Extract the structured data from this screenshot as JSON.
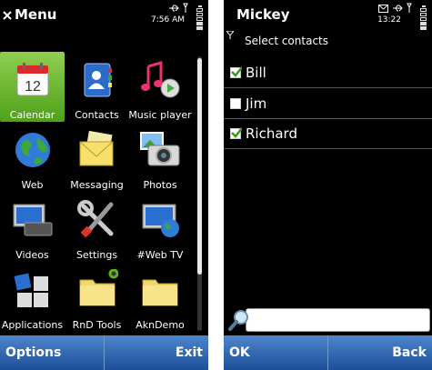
{
  "left": {
    "title": "Menu",
    "time": "7:56 AM",
    "apps": [
      {
        "label": "Calendar",
        "icon": "calendar-icon",
        "badge": "12",
        "selected": true
      },
      {
        "label": "Contacts",
        "icon": "contacts-icon"
      },
      {
        "label": "Music player",
        "icon": "music-player-icon"
      },
      {
        "label": "Web",
        "icon": "globe-icon"
      },
      {
        "label": "Messaging",
        "icon": "envelope-icon"
      },
      {
        "label": "Photos",
        "icon": "camera-icon"
      },
      {
        "label": "Videos",
        "icon": "video-screen-icon"
      },
      {
        "label": "Settings",
        "icon": "tools-icon"
      },
      {
        "label": "#Web TV",
        "icon": "web-tv-icon"
      },
      {
        "label": "Applications",
        "icon": "applications-icon"
      },
      {
        "label": "RnD Tools",
        "icon": "folder-icon"
      },
      {
        "label": "AknDemo",
        "icon": "folder-icon"
      }
    ],
    "softkeys": {
      "left": "Options",
      "right": "Exit"
    }
  },
  "right": {
    "title": "Mickey",
    "time": "13:22",
    "subtitle": "Select contacts",
    "contacts": [
      {
        "name": "Bill",
        "checked": true
      },
      {
        "name": "Jim",
        "checked": false
      },
      {
        "name": "Richard",
        "checked": true
      }
    ],
    "search": {
      "value": ""
    },
    "softkeys": {
      "left": "OK",
      "right": "Back"
    }
  },
  "colors": {
    "accent_green": "#5bb21e",
    "softkey_blue": "#2f64b3",
    "check_green": "#3a9a1a"
  }
}
